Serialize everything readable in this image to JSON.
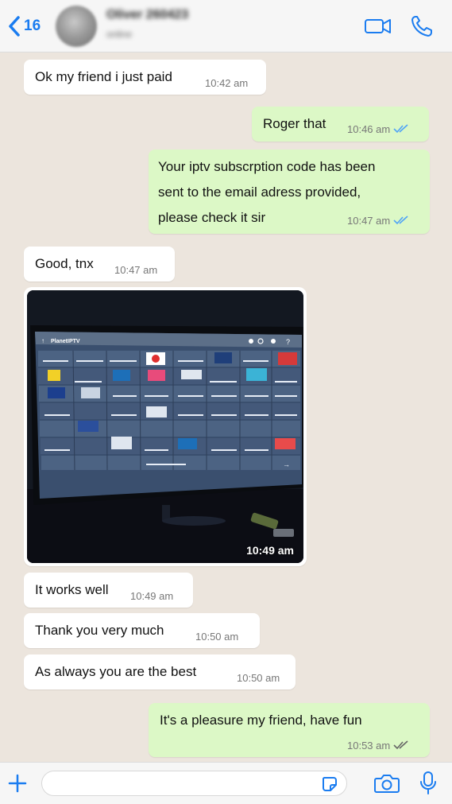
{
  "header": {
    "back_count": "16",
    "contact_name": "Oliver 260423",
    "contact_status": "online"
  },
  "messages": [
    {
      "text": "Ok my friend i just paid",
      "time": "10:42 am",
      "direction": "in"
    },
    {
      "text": "Roger that",
      "time": "10:46 am",
      "direction": "out"
    },
    {
      "lines": [
        "Your iptv subscrption code has been",
        "sent to the email adress provided,",
        "please check it sir"
      ],
      "time": "10:47 am",
      "direction": "out"
    },
    {
      "text": "Good, tnx",
      "time": "10:47 am",
      "direction": "in"
    },
    {
      "image": "photo of a TV screen showing the IPTV channel grid",
      "time": "10:49 am",
      "direction": "in"
    },
    {
      "text": "It works well",
      "time": "10:49 am",
      "direction": "in"
    },
    {
      "text": "Thank you very much",
      "time": "10:50 am",
      "direction": "in"
    },
    {
      "text": "As always you are the best",
      "time": "10:50 am",
      "direction": "in"
    },
    {
      "text": "It's a pleasure my friend, have fun",
      "time": "10:53 am",
      "direction": "out"
    }
  ],
  "photo_screen": {
    "app_name": "PlanetIPTV"
  },
  "composer": {
    "placeholder": ""
  },
  "colors": {
    "accent": "#1a7cf0",
    "outgoing_bubble": "#dcf8c6",
    "incoming_bubble": "#ffffff",
    "chat_background": "#ece5dd",
    "read_ticks": "#4fa3f7"
  },
  "icons": [
    "chevron-left-icon",
    "video-call-icon",
    "phone-icon",
    "plus-icon",
    "sticker-icon",
    "camera-icon",
    "microphone-icon",
    "double-check-icon"
  ]
}
